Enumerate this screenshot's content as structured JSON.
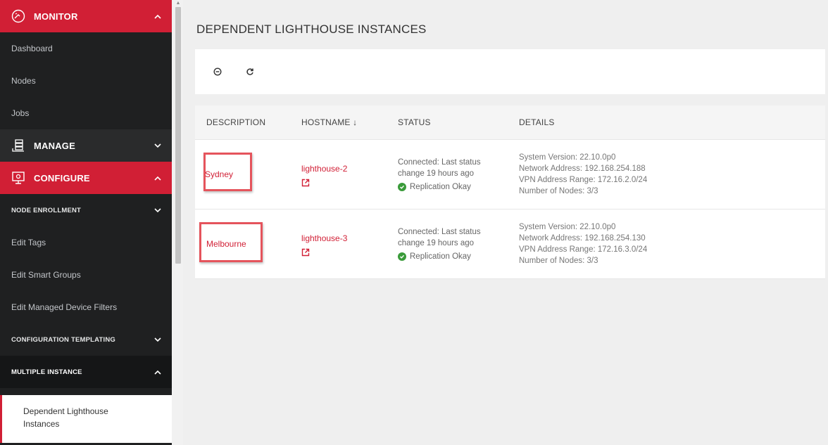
{
  "sidebar": {
    "monitor": {
      "label": "MONITOR",
      "items": [
        "Dashboard",
        "Nodes",
        "Jobs"
      ]
    },
    "manage": {
      "label": "MANAGE"
    },
    "configure": {
      "label": "CONFIGURE",
      "node_enrollment": "NODE ENROLLMENT",
      "items": [
        "Edit Tags",
        "Edit Smart Groups",
        "Edit Managed Device Filters"
      ],
      "config_templating": "CONFIGURATION TEMPLATING",
      "multiple_instance": "MULTIPLE INSTANCE",
      "active_item": "Dependent Lighthouse Instances"
    }
  },
  "page": {
    "title": "DEPENDENT LIGHTHOUSE INSTANCES"
  },
  "table": {
    "headers": {
      "description": "DESCRIPTION",
      "hostname": "HOSTNAME ↓",
      "status": "STATUS",
      "details": "DETAILS"
    },
    "rows": [
      {
        "description": "Sydney",
        "hostname": "lighthouse-2",
        "status_line1": "Connected: Last status",
        "status_line2": "change 19 hours ago",
        "replication": "Replication Okay",
        "details": [
          "System Version: 22.10.0p0",
          "Network Address: 192.168.254.188",
          "VPN Address Range: 172.16.2.0/24",
          "Number of Nodes: 3/3"
        ]
      },
      {
        "description": "Melbourne",
        "hostname": "lighthouse-3",
        "status_line1": "Connected: Last status",
        "status_line2": "change 19 hours ago",
        "replication": "Replication Okay",
        "details": [
          "System Version: 22.10.0p0",
          "Network Address: 192.168.254.130",
          "VPN Address Range: 172.16.3.0/24",
          "Number of Nodes: 3/3"
        ]
      }
    ]
  },
  "icons": {
    "monitor": "gauge-icon",
    "manage": "database-icon",
    "configure": "monitor-gear-icon",
    "add": "add-circle-icon",
    "refresh": "refresh-icon",
    "external": "external-link-icon",
    "check": "check-circle-icon"
  },
  "colors": {
    "accent": "#d11f35",
    "sidebar_bg": "#1f2021",
    "success": "#3a9b3a",
    "highlight_box": "#e5545c"
  }
}
